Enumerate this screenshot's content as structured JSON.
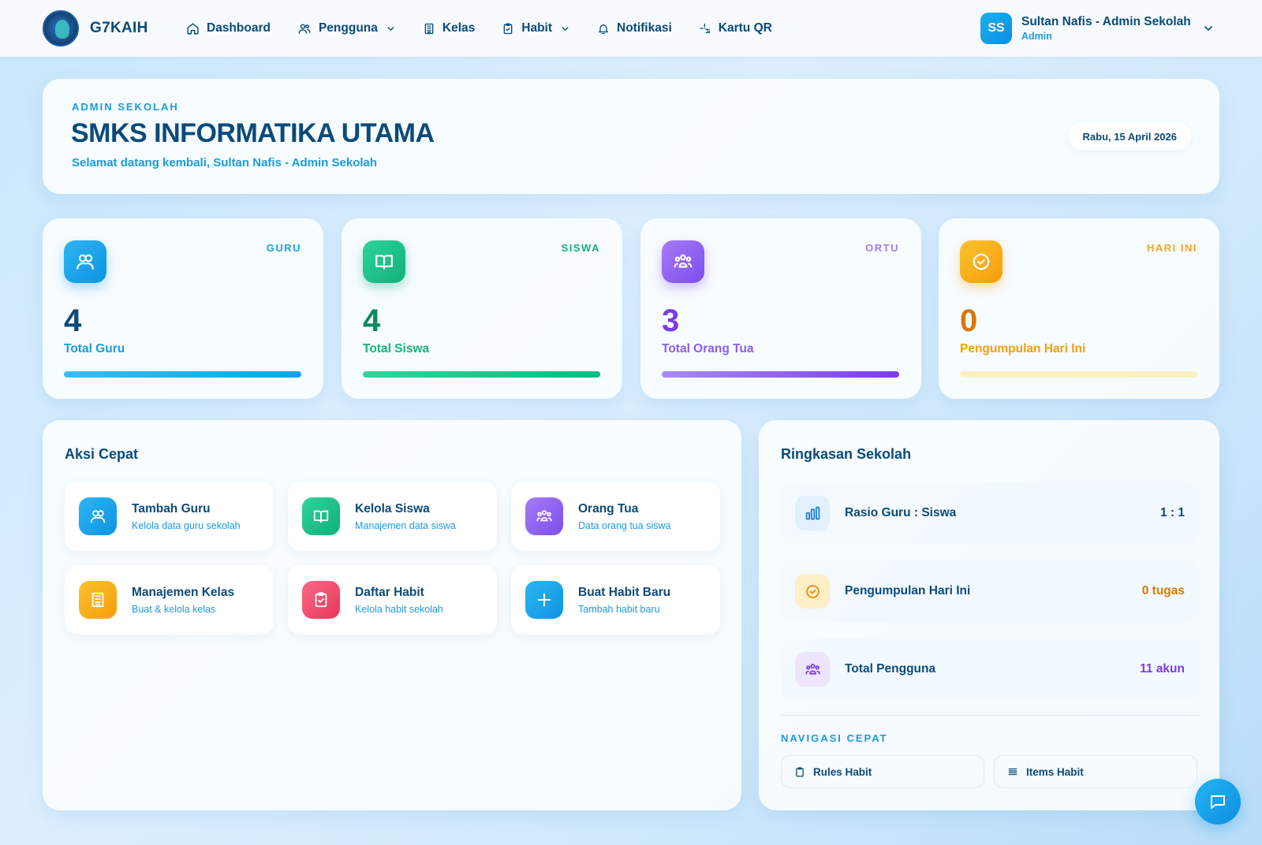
{
  "brand": {
    "name": "G7KAIH"
  },
  "nav": {
    "dashboard": "Dashboard",
    "pengguna": "Pengguna",
    "kelas": "Kelas",
    "habit": "Habit",
    "notifikasi": "Notifikasi",
    "kartu_qr": "Kartu QR"
  },
  "user": {
    "initials": "SS",
    "name": "Sultan Nafis - Admin Sekolah",
    "role": "Admin"
  },
  "hero": {
    "kicker": "ADMIN SEKOLAH",
    "title": "SMKS INFORMATIKA UTAMA",
    "subtitle": "Selamat datang kembali, Sultan Nafis - Admin Sekolah",
    "date": "Rabu, 15 April 2026"
  },
  "stats": [
    {
      "kicker": "GURU",
      "value": "4",
      "label": "Total Guru",
      "progress": 1.0,
      "color": "#1aa3ea"
    },
    {
      "kicker": "SISWA",
      "value": "4",
      "label": "Total Siswa",
      "progress": 1.0,
      "color": "#14b37a"
    },
    {
      "kicker": "ORTU",
      "value": "3",
      "label": "Total Orang Tua",
      "progress": 1.0,
      "color": "#8b5cf6"
    },
    {
      "kicker": "HARI INI",
      "value": "0",
      "label": "Pengumpulan Hari Ini",
      "progress": 0.0,
      "color": "#f59e0b"
    }
  ],
  "quick_actions": {
    "title": "Aksi Cepat",
    "items": [
      {
        "title": "Tambah Guru",
        "subtitle": "Kelola data guru sekolah"
      },
      {
        "title": "Kelola Siswa",
        "subtitle": "Manajemen data siswa"
      },
      {
        "title": "Orang Tua",
        "subtitle": "Data orang tua siswa"
      },
      {
        "title": "Manajemen Kelas",
        "subtitle": "Buat & kelola kelas"
      },
      {
        "title": "Daftar Habit",
        "subtitle": "Kelola habit sekolah"
      },
      {
        "title": "Buat Habit Baru",
        "subtitle": "Tambah habit baru"
      }
    ]
  },
  "summary": {
    "title": "Ringkasan Sekolah",
    "rows": [
      {
        "label": "Rasio Guru : Siswa",
        "value": "1 : 1"
      },
      {
        "label": "Pengumpulan Hari Ini",
        "value": "0 tugas"
      },
      {
        "label": "Total Pengguna",
        "value": "11 akun"
      }
    ],
    "nav_kicker": "NAVIGASI CEPAT",
    "nav_buttons": {
      "rules": "Rules Habit",
      "items": "Items Habit"
    }
  }
}
